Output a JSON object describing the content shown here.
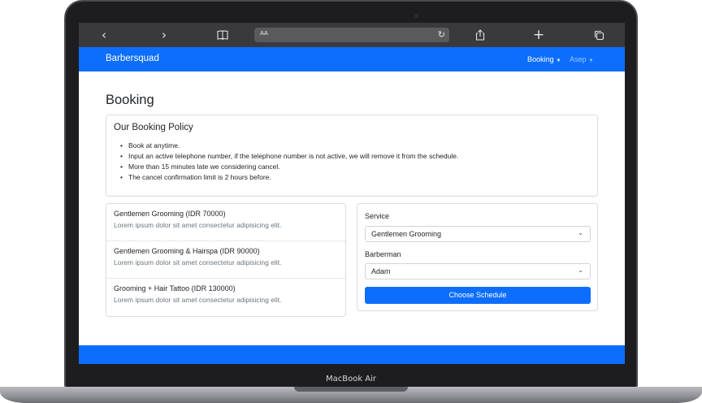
{
  "device": {
    "model_label": "MacBook Air"
  },
  "browser": {
    "back_icon": "chevron-left-icon",
    "forward_icon": "chevron-right-icon",
    "bookmarks_icon": "book-icon",
    "address_text": "AA",
    "reload_icon": "reload-icon",
    "share_icon": "share-icon",
    "new_tab_icon": "plus-icon",
    "tabs_icon": "tabs-icon"
  },
  "navbar": {
    "brand": "Barbersquad",
    "booking_label": "Booking",
    "user_label": "Asep"
  },
  "page": {
    "title": "Booking"
  },
  "policy": {
    "title": "Our Booking Policy",
    "items": [
      "Book at anytime.",
      "Input an active telephone number, if the telephone number is not active, we will remove it from the schedule.",
      "More than 15 minutes late we considering cancel.",
      "The cancel confirmation limit is 2 hours before."
    ]
  },
  "services": [
    {
      "name": "Gentlemen Grooming (IDR 70000)",
      "description": "Lorem ipsum dolor sit amet consectetur adipisicing elit."
    },
    {
      "name": "Gentlemen Grooming & Hairspa (IDR 90000)",
      "description": "Lorem ipsum dolor sit amet consectetur adipisicing elit."
    },
    {
      "name": "Grooming + Hair Tattoo (IDR 130000)",
      "description": "Lorem ipsum dolor sit amet consectetur adipisicing elit."
    }
  ],
  "form": {
    "service_label": "Service",
    "service_value": "Gentlemen Grooming",
    "barberman_label": "Barberman",
    "barberman_value": "Adam",
    "submit_label": "Choose Schedule"
  },
  "colors": {
    "primary": "#0d6efd",
    "browser_chrome": "#3a3a3c",
    "bezel": "#1d1d1f"
  }
}
